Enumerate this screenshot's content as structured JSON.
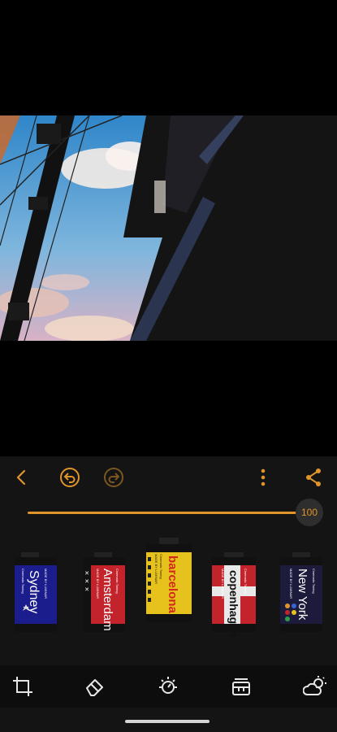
{
  "toolbar": {
    "back_icon": "chevron-left-icon",
    "undo_icon": "undo-icon",
    "redo_icon": "redo-icon",
    "more_icon": "more-vertical-icon",
    "share_icon": "share-icon"
  },
  "slider": {
    "value": 100,
    "value_label": "100"
  },
  "filters": [
    {
      "name": "Sydney",
      "maker": "MADE BY LUMINAR",
      "subtitle": "Cinematic Toning",
      "color": "#1c1d8c"
    },
    {
      "name": "Amsterdam",
      "maker": "MADE BY LUMINAR",
      "subtitle": "Cinematic Toning",
      "color": "#c3232a"
    },
    {
      "name": "barcelona",
      "maker": "MADE BY LUMINAR",
      "subtitle": "Cinematic Toning",
      "color": "#e8c21c"
    },
    {
      "name": "copenhagen",
      "maker": "MADE BY LUMINAR",
      "subtitle": "Cinematic Toning",
      "color": "#e9e9e9"
    },
    {
      "name": "New York",
      "maker": "MADE BY LUMINAR",
      "subtitle": "Cinematic Toning",
      "color": "#1d1b3c"
    }
  ],
  "bottom_tools": [
    "crop-icon",
    "eraser-icon",
    "adjust-light-icon",
    "film-filters-icon",
    "weather-sky-icon"
  ],
  "colors": {
    "accent": "#e0952a",
    "panel": "#141414",
    "background": "#000000"
  }
}
